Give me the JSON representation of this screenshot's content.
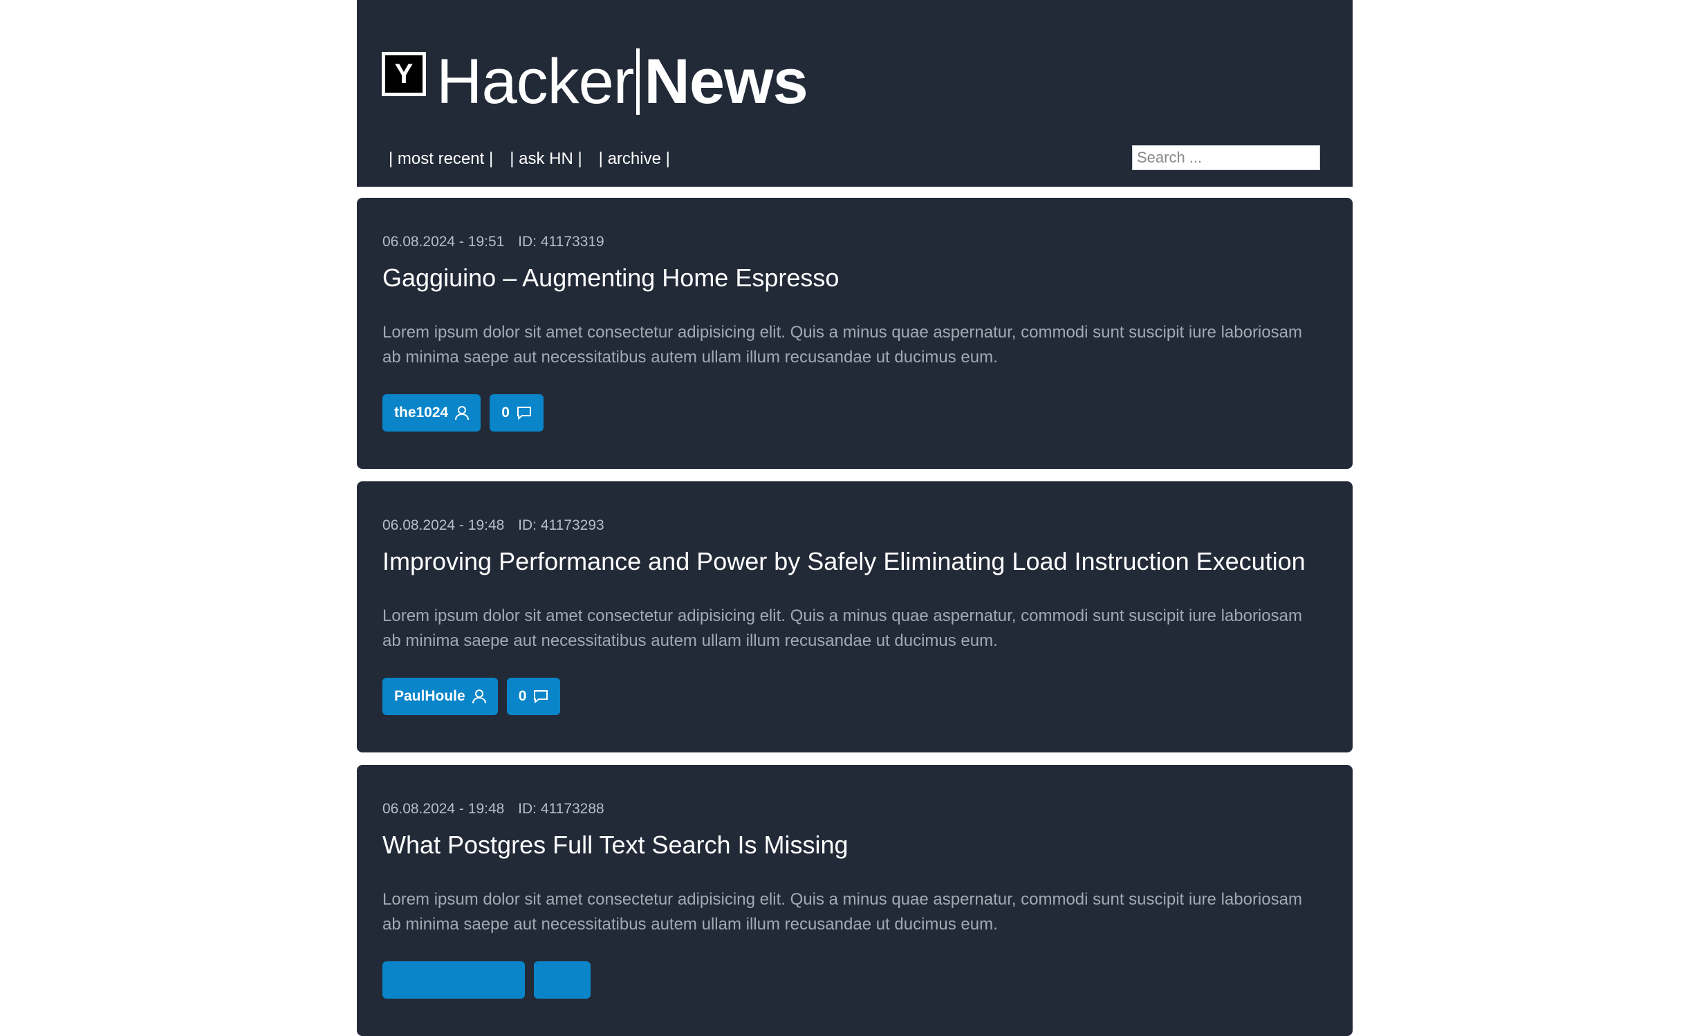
{
  "header": {
    "logo_letter": "Y",
    "logo_text_regular": "Hacker",
    "logo_text_bold": "News",
    "nav": [
      "| most recent |",
      "| ask HN |",
      "| archive |"
    ],
    "search_placeholder": "Search ..."
  },
  "posts": [
    {
      "date": "06.08.2024 - 19:51",
      "id": "ID: 41173319",
      "title": "Gaggiuino – Augmenting Home Espresso",
      "description": "Lorem ipsum dolor sit amet consectetur adipisicing elit. Quis a minus quae aspernatur, commodi sunt suscipit iure laboriosam ab minima saepe aut necessitatibus autem ullam illum recusandae ut ducimus eum.",
      "author": "the1024",
      "comments": "0"
    },
    {
      "date": "06.08.2024 - 19:48",
      "id": "ID: 41173293",
      "title": "Improving Performance and Power by Safely Eliminating Load Instruction Execution",
      "description": "Lorem ipsum dolor sit amet consectetur adipisicing elit. Quis a minus quae aspernatur, commodi sunt suscipit iure laboriosam ab minima saepe aut necessitatibus autem ullam illum recusandae ut ducimus eum.",
      "author": "PaulHoule",
      "comments": "0"
    },
    {
      "date": "06.08.2024 - 19:48",
      "id": "ID: 41173288",
      "title": "What Postgres Full Text Search Is Missing",
      "description": "Lorem ipsum dolor sit amet consectetur adipisicing elit. Quis a minus quae aspernatur, commodi sunt suscipit iure laboriosam ab minima saepe aut necessitatibus autem ullam illum recusandae ut ducimus eum."
    }
  ],
  "colors": {
    "panel": "#222a38",
    "tag": "#0a85c9",
    "meta": "#b7bdc7",
    "body_text": "#a3a9b3"
  },
  "icons": [
    "user-icon",
    "comment-icon"
  ]
}
